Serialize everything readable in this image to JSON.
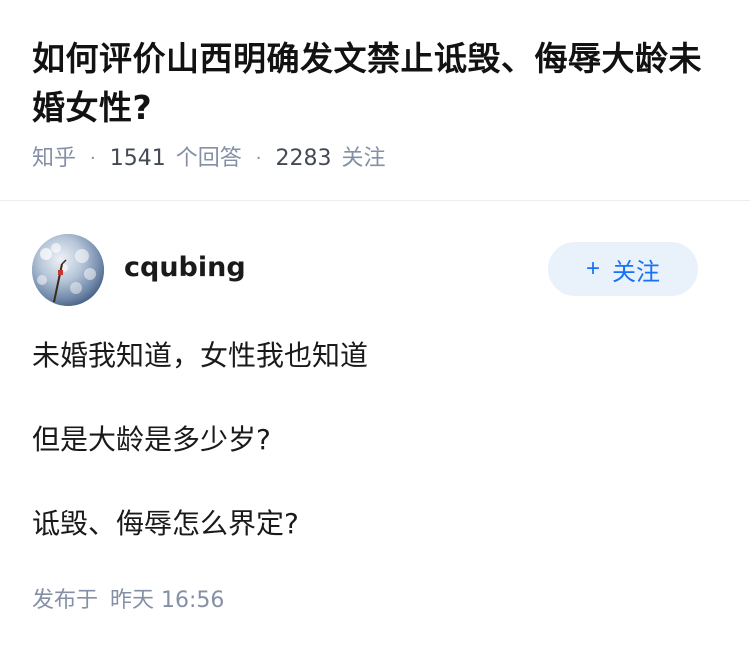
{
  "question": {
    "title": "如何评价山西明确发文禁止诋毁、侮辱大龄未婚女性?",
    "source": "知乎",
    "answers_count": "1541",
    "answers_label": "个回答",
    "followers_count": "2283",
    "followers_label": "关注"
  },
  "answer": {
    "author": {
      "name": "cqubing",
      "avatar_icon": "avatar-image"
    },
    "follow_button": {
      "icon": "+",
      "label": "关注"
    },
    "paragraphs": [
      "未婚我知道，女性我也知道",
      "但是大龄是多少岁?",
      "诋毁、侮辱怎么界定?"
    ],
    "published_label": "发布于",
    "published_time": "昨天 16:56"
  },
  "colors": {
    "text_primary": "#121212",
    "text_secondary": "#8590a6",
    "accent": "#1772f6",
    "button_bg": "#e9f1fb"
  }
}
